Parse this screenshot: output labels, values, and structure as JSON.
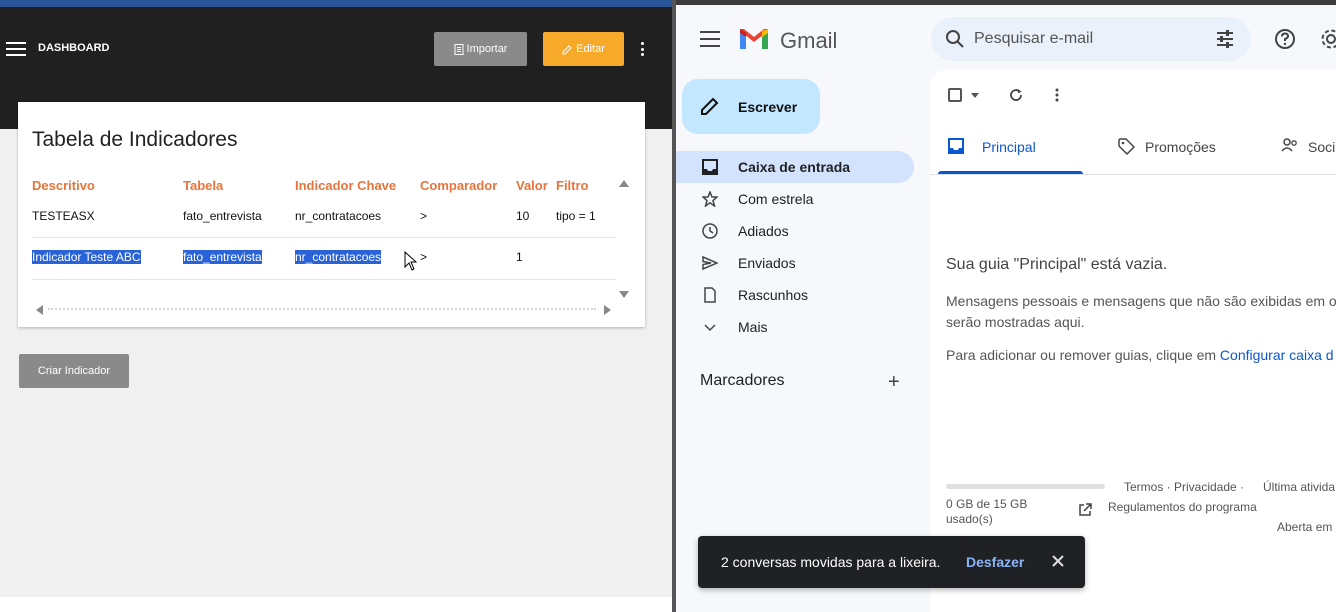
{
  "dashboard": {
    "title": "DASHBOARD",
    "import_label": "Importar",
    "edit_label": "Editar",
    "import_color": "#8a8a8a",
    "edit_color": "#f7a92a",
    "card_title": "Tabela de Indicadores",
    "columns": [
      "Descritivo",
      "Tabela",
      "Indicador Chave",
      "Comparador",
      "Valor",
      "Filtro"
    ],
    "rows": [
      {
        "descritivo": "TESTEASX",
        "tabela": "fato_entrevista",
        "indicador_chave": "nr_contratacoes",
        "comparador": ">",
        "valor": "10",
        "filtro": "tipo = 1"
      },
      {
        "descritivo": "Indicador Teste ABC",
        "tabela": "fato_entrevista",
        "indicador_chave": "nr_contratacoes",
        "comparador": ">",
        "valor": "1",
        "filtro": ""
      }
    ],
    "create_label": "Criar Indicador"
  },
  "gmail": {
    "app_name": "Gmail",
    "search_placeholder": "Pesquisar e-mail",
    "compose_label": "Escrever",
    "nav": [
      {
        "label": "Caixa de entrada",
        "icon": "inbox-icon",
        "active": true
      },
      {
        "label": "Com estrela",
        "icon": "star-icon"
      },
      {
        "label": "Adiados",
        "icon": "clock-icon"
      },
      {
        "label": "Enviados",
        "icon": "send-icon"
      },
      {
        "label": "Rascunhos",
        "icon": "draft-icon"
      },
      {
        "label": "Mais",
        "icon": "chevron-down-icon"
      }
    ],
    "labels_title": "Marcadores",
    "tabs": [
      "Principal",
      "Promoções",
      "Soci"
    ],
    "empty_title": "Sua guia \"Principal\" está vazia.",
    "empty_desc_1": "Mensagens pessoais e mensagens que não são exibidas em o",
    "empty_desc_2": "serão mostradas aqui.",
    "empty_cfg_prefix": "Para adicionar ou remover guias, clique em ",
    "empty_cfg_link": "Configurar caixa d",
    "storage": "0 GB de 15 GB usado(s)",
    "storage_used_fraction": 0.0,
    "terms": "Termos · Privacidade ·",
    "policies": "Regulamentos do programa",
    "last_activity": "Última ativida",
    "open_in": "Aberta em",
    "snackbar_text": "2 conversas movidas para a lixeira.",
    "snackbar_undo": "Desfazer",
    "accent": "#0b57d0"
  }
}
